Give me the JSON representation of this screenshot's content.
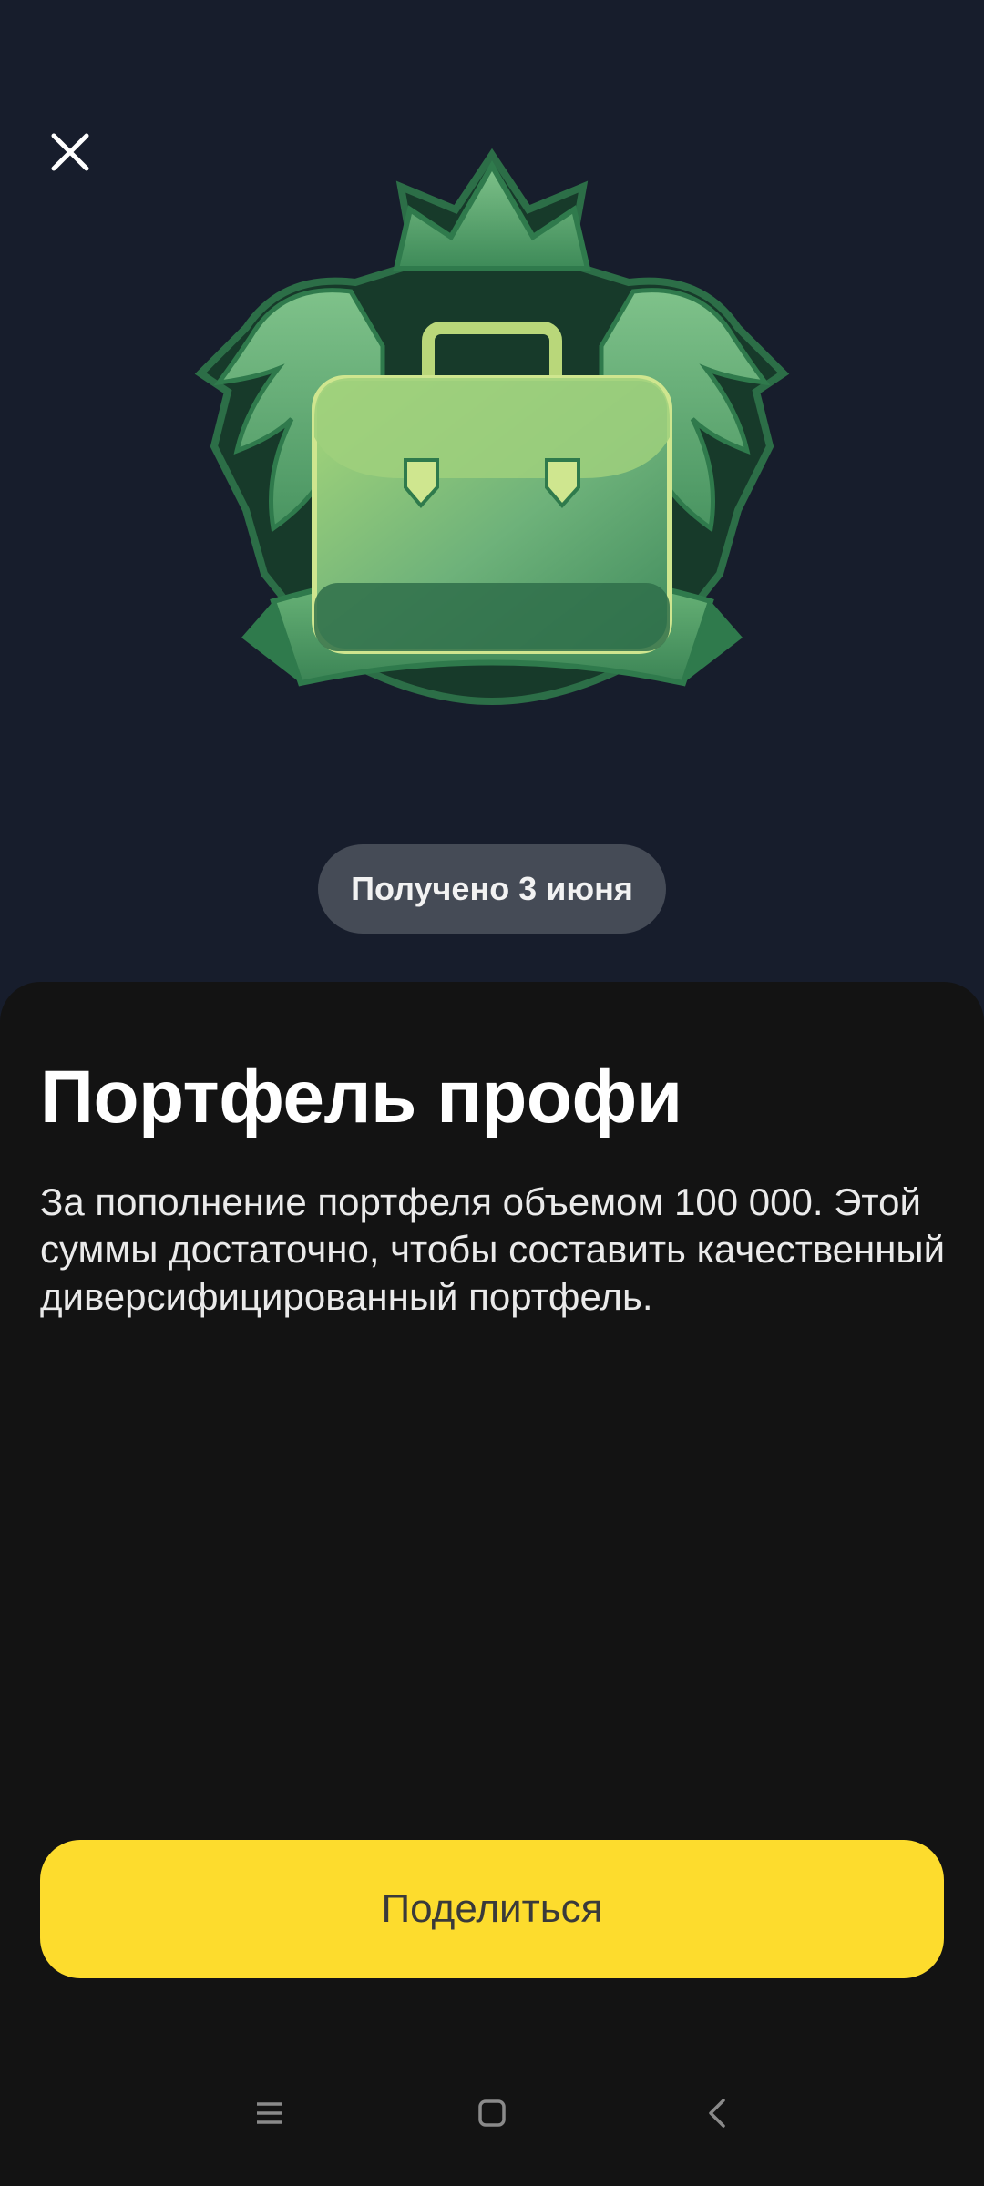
{
  "hero": {
    "close_icon": "close-icon",
    "badge_image": "briefcase-crest-badge",
    "received_label": "Получено 3 июня"
  },
  "achievement": {
    "title": "Портфель профи",
    "description": "За пополнение портфеля объемом 100 000. Этой суммы достаточно, чтобы составить качественный диверсифицированный портфель."
  },
  "actions": {
    "share_label": "Поделиться"
  },
  "navbar": {
    "menu_icon": "menu-icon",
    "home_icon": "home-icon",
    "back_icon": "back-icon"
  },
  "colors": {
    "hero_background": "#171d2c",
    "sheet_background": "#131313",
    "accent_yellow": "#fddc2d",
    "badge_green": "#4f9a62"
  }
}
